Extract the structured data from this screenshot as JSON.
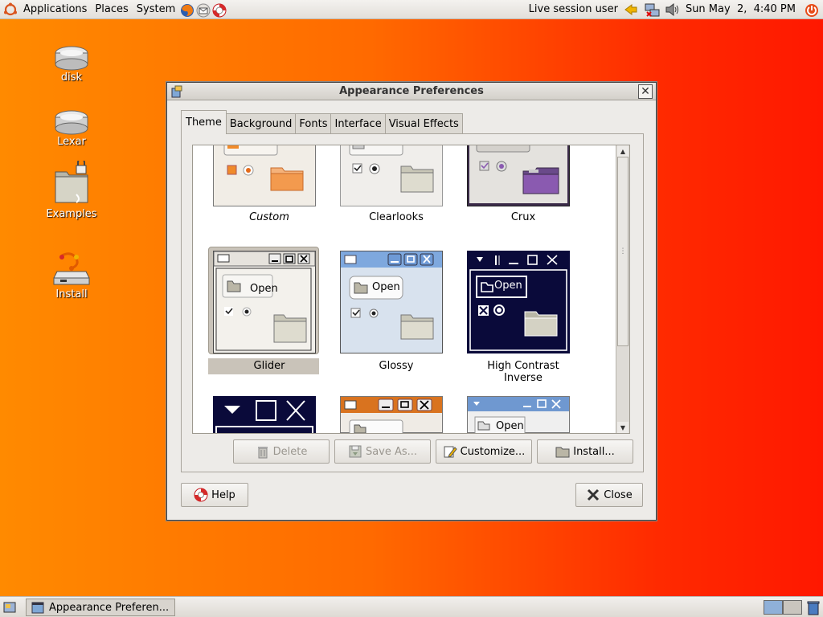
{
  "top_panel": {
    "menus": [
      "Applications",
      "Places",
      "System"
    ],
    "user": "Live session user",
    "clock": "Sun May  2,  4:40 PM"
  },
  "desktop": {
    "icons": [
      {
        "label": "disk",
        "icon": "drive-icon"
      },
      {
        "label": "Lexar",
        "icon": "drive-icon"
      },
      {
        "label": "Examples",
        "icon": "folder-lock-icon"
      },
      {
        "label": "Install",
        "icon": "installer-icon"
      }
    ]
  },
  "window": {
    "title": "Appearance Preferences",
    "tabs": [
      "Theme",
      "Background",
      "Fonts",
      "Interface",
      "Visual Effects"
    ],
    "active_tab": "Theme",
    "themes": [
      {
        "name": "Custom",
        "italic": true
      },
      {
        "name": "Clearlooks"
      },
      {
        "name": "Crux"
      },
      {
        "name": "Glider",
        "selected": true
      },
      {
        "name": "Glossy"
      },
      {
        "name": "High Contrast Inverse"
      }
    ],
    "preview_open_label": "Open",
    "buttons": {
      "delete": "Delete",
      "save_as": "Save As...",
      "customize": "Customize...",
      "install": "Install...",
      "help": "Help",
      "close": "Close"
    }
  },
  "taskbar": {
    "task_label": "Appearance Preferen..."
  },
  "colors": {
    "desktop_left": "#ff8a00",
    "desktop_right": "#ff1800",
    "selection": "#c9c3b9"
  }
}
